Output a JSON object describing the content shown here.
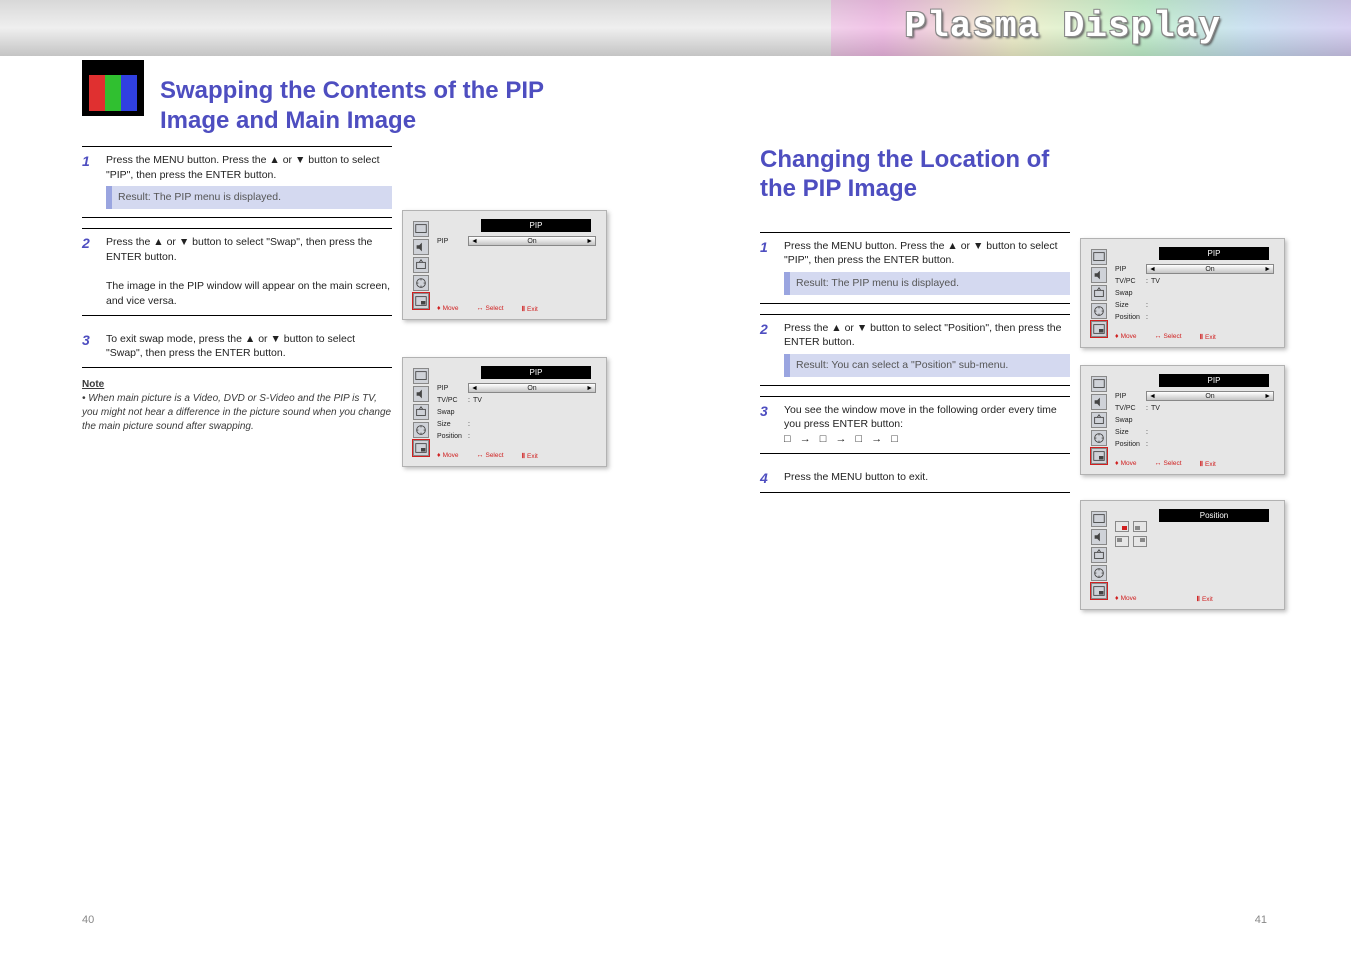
{
  "banner": {
    "title": "Plasma Display"
  },
  "title_line1": "Swapping the Contents of the PIP",
  "title_line2": "Image and Main Image",
  "left": {
    "step1": {
      "num": "1",
      "text_a": "Press the MENU button. Press the ▲ or ▼ button to select \"PIP\", then press the ENTER button.",
      "result": "Result: The PIP menu is displayed."
    },
    "step2": {
      "num": "2",
      "text_a": "Press the ▲ or ▼ button to select \"Swap\", then press the ENTER button.",
      "text_b": "The image in the PIP window will appear on the main screen, and vice versa."
    },
    "step3": {
      "num": "3",
      "text_a": "To exit swap mode, press the ▲ or ▼ button to select \"Swap\", then press the ENTER button."
    },
    "note_label": "Note",
    "note_text": "When main picture is a Video, DVD or S-Video and the PIP is TV, you might not hear a difference in the picture sound when you change the main picture sound after swapping."
  },
  "right": {
    "heading": "Changing the Location of the PIP Image",
    "step1": {
      "num": "1",
      "text_a": "Press the MENU button. Press the ▲ or ▼ button to select \"PIP\", then press the ENTER button.",
      "result": "Result: The PIP menu is displayed."
    },
    "step2": {
      "num": "2",
      "text_a": "Press the ▲ or ▼ button to select \"Position\", then press the ENTER button.",
      "result": "Result: You can select a \"Position\" sub-menu."
    },
    "step3": {
      "num": "3",
      "text_a": "You see the window move in the following order every time you press ENTER button:",
      "order": "□ → □ → □ → □"
    },
    "step4": {
      "num": "4",
      "text_a": "Press the MENU button to exit."
    }
  },
  "osd": {
    "common": {
      "footer_move": "Move",
      "footer_select": "Select",
      "footer_exit": "Exit"
    },
    "o1": {
      "title": "PIP",
      "pip_label": "PIP",
      "pip_value": "On"
    },
    "o2": {
      "title": "PIP",
      "pip_label": "PIP",
      "pip_value": "On",
      "tvpc_label": "TV/PC",
      "tvpc_value": "TV",
      "swap_label": "Swap",
      "size_label": "Size",
      "position_label": "Position"
    },
    "o3": {
      "title": "PIP",
      "pip_label": "PIP",
      "pip_value": "On",
      "tvpc_label": "TV/PC",
      "tvpc_value": "TV",
      "swap_label": "Swap",
      "size_label": "Size",
      "position_label": "Position"
    },
    "o4": {
      "title": "PIP",
      "pip_label": "PIP",
      "pip_value": "On",
      "tvpc_label": "TV/PC",
      "tvpc_value": "TV",
      "swap_label": "Swap",
      "size_label": "Size",
      "position_label": "Position"
    },
    "o5": {
      "title": "Position"
    }
  },
  "pages": {
    "left": "40",
    "right": "41"
  }
}
